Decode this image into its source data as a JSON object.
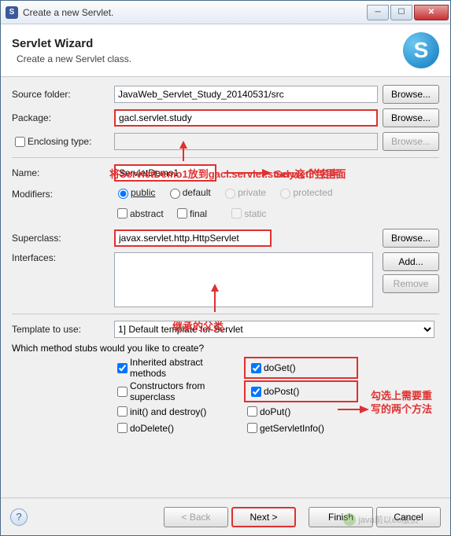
{
  "window": {
    "title": "Create a new Servlet."
  },
  "header": {
    "title": "Servlet Wizard",
    "subtitle": "Create a new Servlet class.",
    "icon_letter": "S"
  },
  "labels": {
    "source_folder": "Source folder:",
    "package": "Package:",
    "enclosing_type": "Enclosing type:",
    "name": "Name:",
    "modifiers": "Modifiers:",
    "superclass": "Superclass:",
    "interfaces": "Interfaces:",
    "template": "Template to use:",
    "stubs_q": "Which method stubs would you like to create?"
  },
  "fields": {
    "source_folder": "JavaWeb_Servlet_Study_20140531/src",
    "package": "gacl.servlet.study",
    "enclosing_type": "",
    "name": "ServletDemo1",
    "superclass": "javax.servlet.http.HttpServlet"
  },
  "buttons": {
    "browse": "Browse...",
    "add": "Add...",
    "remove": "Remove",
    "back": "< Back",
    "next": "Next >",
    "finish": "Finish",
    "cancel": "Cancel"
  },
  "modifiers": {
    "public": "public",
    "default": "default",
    "private": "private",
    "protected": "protected",
    "abstract": "abstract",
    "final": "final",
    "static": "static"
  },
  "template": {
    "selected": "1] Default template for Servlet"
  },
  "stubs": {
    "inherited": "Inherited abstract methods",
    "constructors": "Constructors from superclass",
    "init_destroy": "init() and destroy()",
    "doDelete": "doDelete()",
    "doGet": "doGet()",
    "doPost": "doPost()",
    "doPut": "doPut()",
    "getServletInfo": "getServletInfo()"
  },
  "annotations": {
    "package_note": "将ServletDemo1放到gacl.servlet.study这个包里面",
    "name_note": "Servlet的名字",
    "super_note": "继承的父类",
    "stubs_note": "勾选上需要重写的两个方法"
  },
  "watermark": "java前以eb版员"
}
